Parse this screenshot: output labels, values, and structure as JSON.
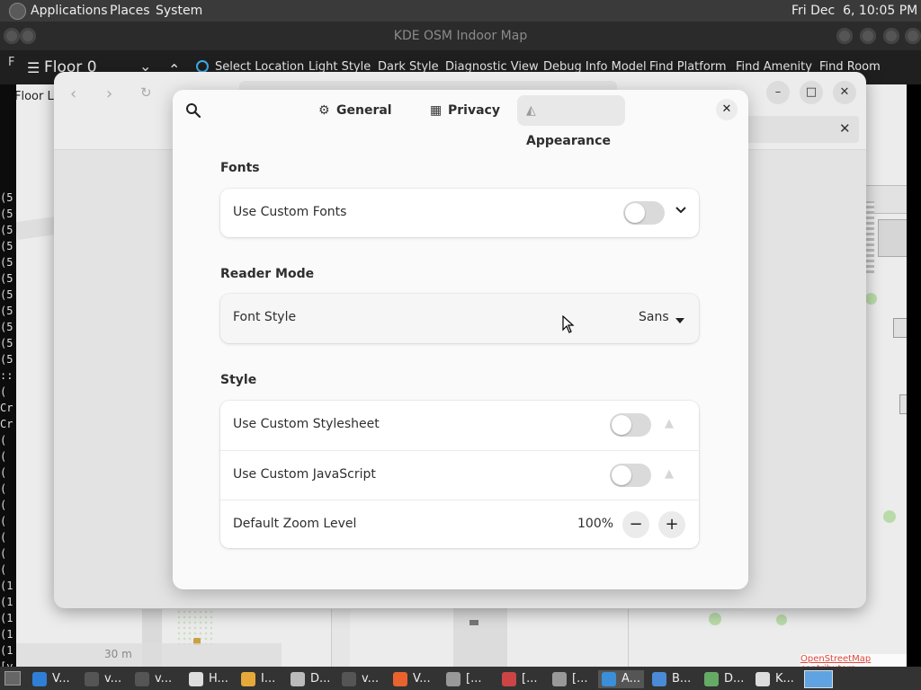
{
  "top_panel": {
    "menus": [
      "Applications",
      "Places",
      "System"
    ],
    "clock": "Fri Dec  6, 10:05 PM"
  },
  "app": {
    "title": "KDE OSM Indoor Map",
    "floor": "Floor 0",
    "floor_side_label": "F",
    "floor_level_label": "Floor Le",
    "toolbar": [
      "Select Location",
      "Light Style",
      "Dark Style",
      "Diagnostic View",
      "Debug Info Model",
      "Find Platform",
      "Find Amenity",
      "Find Room"
    ],
    "scale_label": "30 m",
    "attribution": "OpenStreetMap contributors"
  },
  "terminal": {
    "lines": [
      "(5",
      "(5",
      "(5",
      "(5",
      "(5",
      "(5",
      "(5",
      "(5",
      "(5",
      "(5",
      "(5",
      "::",
      "(",
      "Cr",
      "Cr",
      "(",
      "(",
      "(",
      "(",
      "(",
      "(",
      "(",
      "(",
      "(",
      "(1",
      "(1",
      "(1",
      "(1",
      "(1",
      "[v"
    ]
  },
  "dialog": {
    "tabs": [
      {
        "label": "General",
        "icon": "gear-icon"
      },
      {
        "label": "Privacy",
        "icon": "privacy-icon"
      },
      {
        "label": "Appearance",
        "icon": "appearance-icon",
        "active": true
      }
    ],
    "sections": {
      "fonts": {
        "title": "Fonts",
        "use_custom_fonts": {
          "label": "Use Custom Fonts",
          "enabled": false
        }
      },
      "reader_mode": {
        "title": "Reader Mode",
        "font_style": {
          "label": "Font Style",
          "value": "Sans"
        }
      },
      "style": {
        "title": "Style",
        "custom_stylesheet": {
          "label": "Use Custom Stylesheet",
          "enabled": false
        },
        "custom_javascript": {
          "label": "Use Custom JavaScript",
          "enabled": false
        },
        "zoom": {
          "label": "Default Zoom Level",
          "value": "100%"
        }
      }
    }
  },
  "taskbar": {
    "items": [
      {
        "label": "V...",
        "color": "#2f7fd6"
      },
      {
        "label": "v...",
        "color": "#555"
      },
      {
        "label": "v...",
        "color": "#555"
      },
      {
        "label": "H...",
        "color": "#ddd"
      },
      {
        "label": "I...",
        "color": "#e5a93b"
      },
      {
        "label": "D...",
        "color": "#bbb"
      },
      {
        "label": "v...",
        "color": "#555"
      },
      {
        "label": "V...",
        "color": "#e8632d"
      },
      {
        "label": "[...",
        "color": "#999"
      },
      {
        "label": "[...",
        "color": "#c44"
      },
      {
        "label": "[...",
        "color": "#999"
      },
      {
        "label": "A...",
        "color": "#3a8fd8"
      },
      {
        "label": "B...",
        "color": "#4a8ad6"
      },
      {
        "label": "D...",
        "color": "#6a6"
      },
      {
        "label": "K...",
        "color": "#ddd"
      }
    ]
  },
  "colors": {
    "accent": "#3584e4",
    "dialog_bg": "#fafafa",
    "panel_bg": "#3a3a3a"
  }
}
